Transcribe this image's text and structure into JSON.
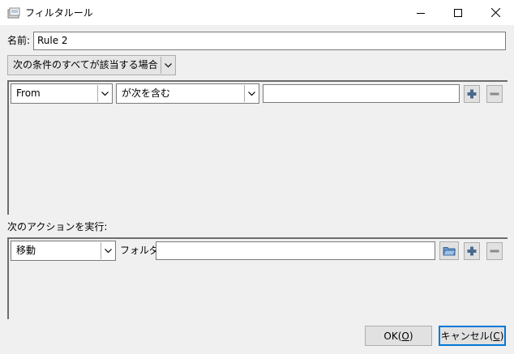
{
  "window": {
    "title": "フィルタルール",
    "controls": {
      "minimize_icon": "minimize-icon",
      "maximize_icon": "maximize-icon",
      "close_icon": "close-icon"
    }
  },
  "name": {
    "label": "名前:",
    "value": "Rule 2"
  },
  "match_mode": {
    "selected": "次の条件のすべてが該当する場合"
  },
  "conditions": [
    {
      "field": "From",
      "operator": "が次を含む",
      "value": ""
    }
  ],
  "actions_section": {
    "label": "次のアクションを実行:"
  },
  "actions": [
    {
      "action": "移動",
      "folder_label": "フォルダ:",
      "folder_value": ""
    }
  ],
  "buttons": {
    "ok_text": "OK(",
    "ok_key": "O",
    "ok_end": ")",
    "cancel_text": "キャンセル(",
    "cancel_key": "C",
    "cancel_end": ")"
  },
  "colors": {
    "accent": "#0078d7",
    "plus_icon": "#4a6a8c",
    "folder_icon": "#6c96c8"
  }
}
